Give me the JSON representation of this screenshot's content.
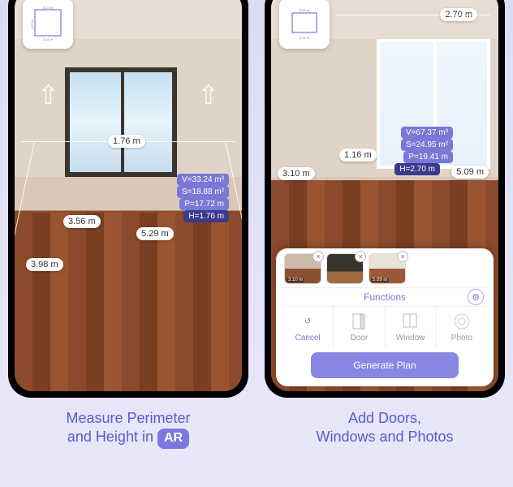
{
  "panel1": {
    "minimap": {
      "w": "5.22 m",
      "h1": "3.61 m",
      "h2": "1.47 m",
      "b": "2.04 m"
    },
    "room_width_label": "1.76 m",
    "dim_a": "3.56 m",
    "dim_b": "5.29 m",
    "dim_c": "3.98 m",
    "stats": {
      "v": "V=33.24 m³",
      "s": "S=18.88 m²",
      "p": "P=17.72 m",
      "h": "H=1.76 m"
    },
    "caption_line1": "Measure Perimeter",
    "caption_line2": "and Height in",
    "ar_badge": "AR"
  },
  "panel2": {
    "minimap": {
      "w": "5.08 m",
      "h": "4.91 m"
    },
    "top_label": "2.70 m",
    "mid_label": "1.16 m",
    "left_label": "3.10 m",
    "right_label": "5.09 m",
    "stats": {
      "v": "V=67.37 m³",
      "s": "S=24.95 m²",
      "p": "P=19.41 m",
      "h": "H=2.70 m"
    },
    "thumbs": [
      {
        "label": "3.10 m"
      },
      {
        "label": ""
      },
      {
        "label": "5.09 m"
      }
    ],
    "functions_label": "Functions",
    "fn": {
      "cancel": "Cancel",
      "door": "Door",
      "window": "Window",
      "photo": "Photo"
    },
    "generate": "Generate Plan",
    "caption_line1": "Add Doors,",
    "caption_line2": "Windows and Photos"
  }
}
